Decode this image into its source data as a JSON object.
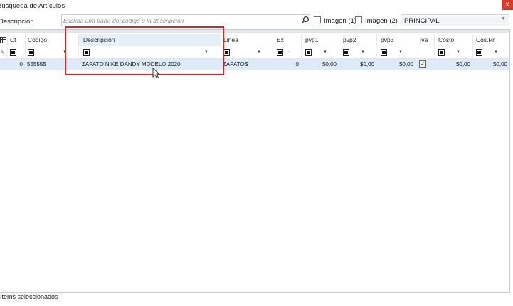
{
  "window": {
    "title": "Busqueda de Artículos",
    "close_glyph": "x"
  },
  "search": {
    "label": "Descripción",
    "placeholder": "Escriba una parte del código o la descripción",
    "value": "",
    "image1_label": "Imagen (1)",
    "image2_label": "Imagen (2)",
    "warehouse_value": "PRINCIPAL"
  },
  "grid": {
    "columns": [
      "Ct",
      "Codigo",
      "Descripcion",
      "Linea",
      "Ex",
      "pvp1",
      "pvp2",
      "pvp3",
      "Iva",
      "Costo",
      "Cos.Pr."
    ],
    "rows": [
      {
        "ct": "0",
        "codigo": "555555",
        "descripcion": "ZAPATO NIKE DANDY MODELO 2020",
        "linea": "ZAPATOS",
        "ex": "0",
        "pvp1": "$0,00",
        "pvp2": "$0,00",
        "pvp3": "$0,00",
        "iva_checked": true,
        "costo": "$0,00",
        "cospr": "$0,00"
      }
    ]
  },
  "footer": {
    "status_text": "Items seleccionados"
  },
  "colors": {
    "highlight": "#e8201c",
    "selected_row": "#dcebf7"
  },
  "icons": [
    "search-icon",
    "close-icon",
    "mouse-cursor-icon",
    "filter-checkbox-icon",
    "dropdown-arrow-icon"
  ]
}
